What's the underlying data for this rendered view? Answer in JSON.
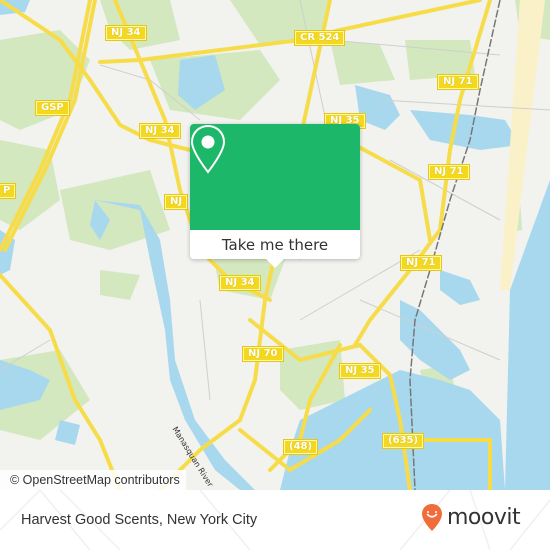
{
  "map": {
    "road_labels": [
      {
        "id": "nj34-top",
        "text": "NJ 34"
      },
      {
        "id": "cr524",
        "text": "CR 524"
      },
      {
        "id": "gsp",
        "text": "GSP"
      },
      {
        "id": "nj34-mid",
        "text": "NJ 34"
      },
      {
        "id": "nj35-top",
        "text": "NJ 35"
      },
      {
        "id": "nj71-top",
        "text": "NJ 71"
      },
      {
        "id": "nj71-mid",
        "text": "NJ 71"
      },
      {
        "id": "gsp-left",
        "text": "P"
      },
      {
        "id": "nj-left",
        "text": "NJ"
      },
      {
        "id": "nj34-low",
        "text": "NJ 34"
      },
      {
        "id": "nj71-low",
        "text": "NJ 71"
      },
      {
        "id": "nj70",
        "text": "NJ 70"
      },
      {
        "id": "nj35-low",
        "text": "NJ 35"
      },
      {
        "id": "r48",
        "text": "(48)"
      },
      {
        "id": "r635",
        "text": "(635)"
      }
    ],
    "water_label": "Manasquan River",
    "attribution": "© OpenStreetMap contributors",
    "colors": {
      "land": "#f2f2ef",
      "park": "#d3e8bf",
      "water": "#a8d8ee",
      "road": "#f7dc4a",
      "beach": "#fbf1c8"
    }
  },
  "popup": {
    "icon": "map-pin-icon",
    "action_label": "Take me there",
    "accent_color": "#1db76a"
  },
  "footer": {
    "place_name": "Harvest Good Scents, New York City",
    "brand_name": "moovit",
    "brand_color": "#f26b3a"
  }
}
